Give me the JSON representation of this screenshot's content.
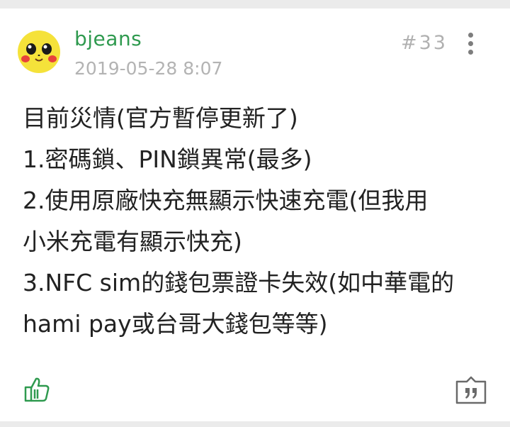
{
  "post": {
    "username": "bjeans",
    "timestamp": "2019-05-28 8:07",
    "floor": "#33",
    "lines": [
      "目前災情(官方暫停更新了)",
      "1.密碼鎖、PIN鎖異常(最多)",
      "2.使用原廠快充無顯示快速充電(但我用",
      "小米充電有顯示快充)",
      "3.NFC sim的錢包票證卡失效(如中華電的",
      "hami pay或台哥大錢包等等)"
    ]
  },
  "icons": {
    "avatar": "pikachu-avatar",
    "more": "more-vertical-icon",
    "like": "thumbs-up-icon",
    "quote": "quote-reply-icon"
  },
  "colors": {
    "username": "#2f9a4f",
    "meta": "#b3b3b3",
    "like": "#2f9a4f",
    "background": "#ebebeb"
  }
}
